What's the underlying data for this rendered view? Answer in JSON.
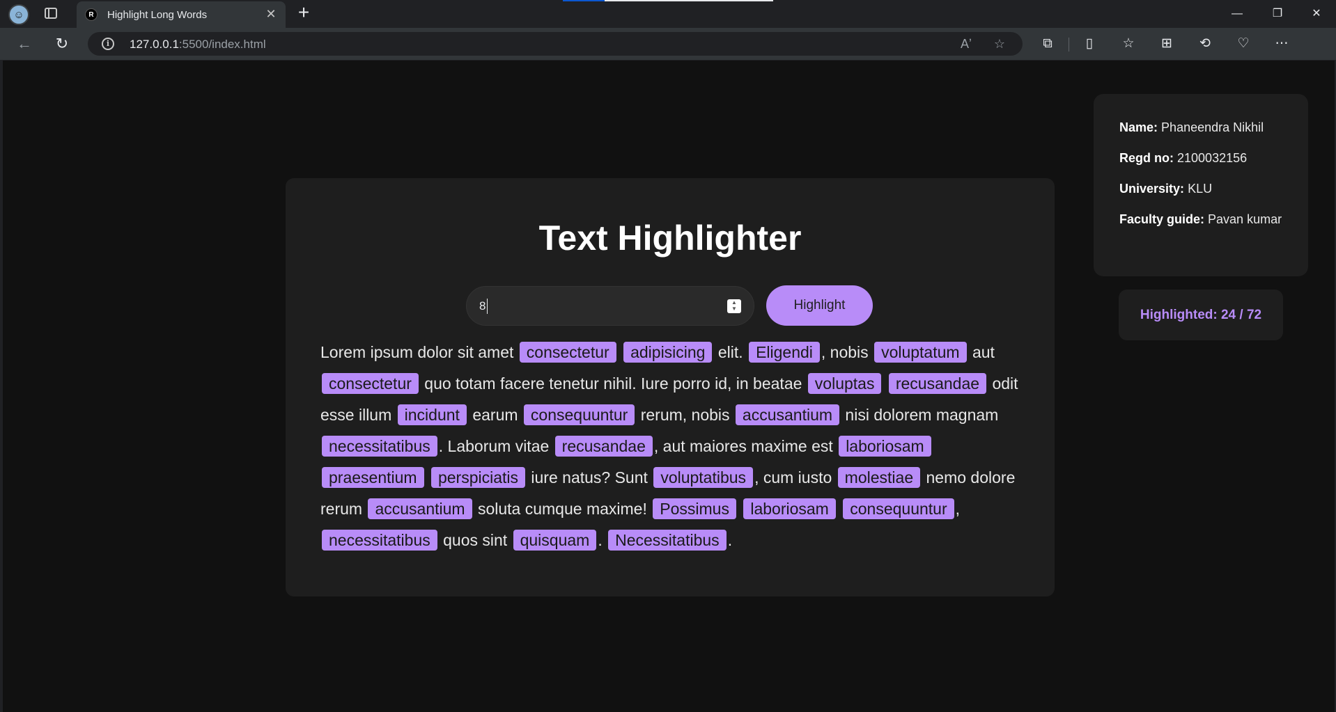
{
  "browser": {
    "tab_title": "Highlight Long Words",
    "tab_favicon_letter": "R",
    "url_host": "127.0.0.1",
    "url_path": ":5500/index.html",
    "read_aloud_glyph": "Aʼ"
  },
  "app": {
    "title": "Text Highlighter",
    "input_value": "8",
    "highlight_button": "Highlight",
    "paragraph": [
      {
        "t": "Lorem ipsum dolor sit amet "
      },
      {
        "t": "consectetur",
        "h": true
      },
      {
        "t": " "
      },
      {
        "t": "adipisicing",
        "h": true
      },
      {
        "t": " elit. "
      },
      {
        "t": "Eligendi",
        "h": true
      },
      {
        "t": ", nobis "
      },
      {
        "t": "voluptatum",
        "h": true
      },
      {
        "t": " aut "
      },
      {
        "t": "consectetur",
        "h": true
      },
      {
        "t": " quo totam facere tenetur nihil. Iure porro id, in beatae "
      },
      {
        "t": "voluptas",
        "h": true
      },
      {
        "t": " "
      },
      {
        "t": "recusandae",
        "h": true
      },
      {
        "t": " odit esse illum "
      },
      {
        "t": "incidunt",
        "h": true
      },
      {
        "t": " earum "
      },
      {
        "t": "consequuntur",
        "h": true
      },
      {
        "t": " rerum, nobis "
      },
      {
        "t": "accusantium",
        "h": true
      },
      {
        "t": " nisi dolorem magnam "
      },
      {
        "t": "necessitatibus",
        "h": true
      },
      {
        "t": ". Laborum vitae "
      },
      {
        "t": "recusandae",
        "h": true
      },
      {
        "t": ", aut maiores maxime est "
      },
      {
        "t": "laboriosam",
        "h": true
      },
      {
        "t": " "
      },
      {
        "t": "praesentium",
        "h": true
      },
      {
        "t": " "
      },
      {
        "t": "perspiciatis",
        "h": true
      },
      {
        "t": " iure natus? Sunt "
      },
      {
        "t": "voluptatibus",
        "h": true
      },
      {
        "t": ", cum iusto "
      },
      {
        "t": "molestiae",
        "h": true
      },
      {
        "t": " nemo dolore rerum "
      },
      {
        "t": "accusantium",
        "h": true
      },
      {
        "t": " soluta cumque maxime! "
      },
      {
        "t": "Possimus",
        "h": true
      },
      {
        "t": " "
      },
      {
        "t": "laboriosam",
        "h": true
      },
      {
        "t": " "
      },
      {
        "t": "consequuntur",
        "h": true
      },
      {
        "t": ", "
      },
      {
        "t": "necessitatibus",
        "h": true
      },
      {
        "t": " quos sint "
      },
      {
        "t": "quisquam",
        "h": true
      },
      {
        "t": ". "
      },
      {
        "t": "Necessitatibus",
        "h": true
      },
      {
        "t": "."
      }
    ]
  },
  "info": {
    "name_label": "Name:",
    "name_value": "Phaneendra Nikhil",
    "regd_label": "Regd no:",
    "regd_value": "2100032156",
    "univ_label": "University:",
    "univ_value": "KLU",
    "guide_label": "Faculty guide:",
    "guide_value": "Pavan kumar"
  },
  "count_label": "Highlighted: 24 / 72",
  "colors": {
    "highlight": "#b88cf8",
    "page_bg": "#111111",
    "card_bg": "#1e1e1e"
  }
}
